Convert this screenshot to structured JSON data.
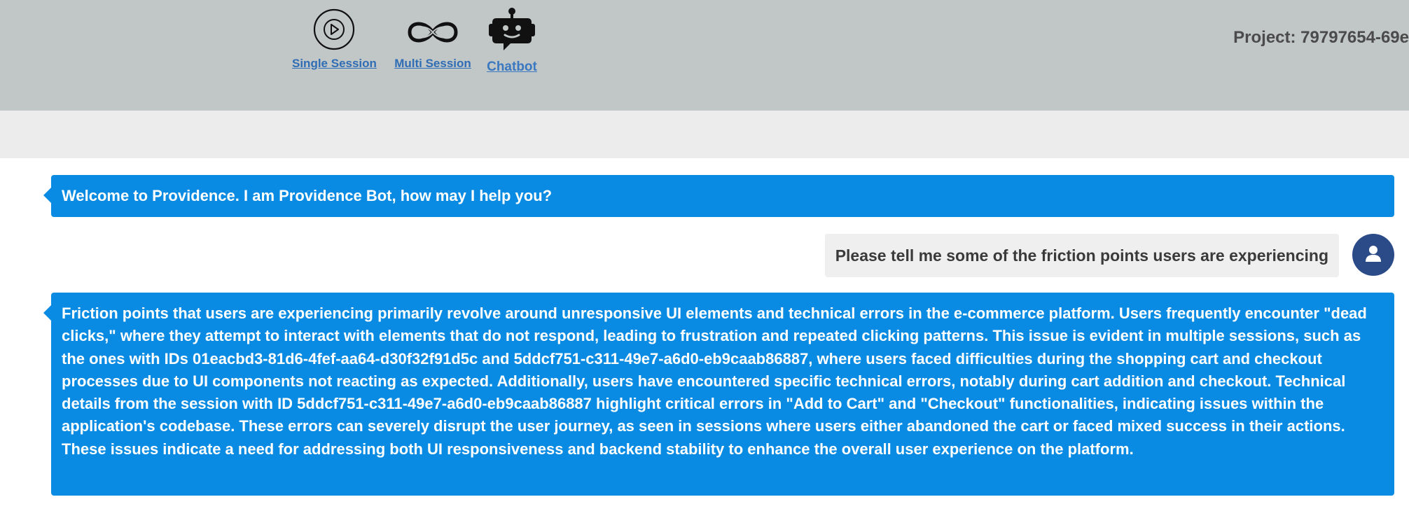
{
  "nav": {
    "single_session_label": "Single Session",
    "multi_session_label": "Multi Session",
    "chatbot_label": "Chatbot"
  },
  "project_label": "Project: 79797654-69e",
  "chat": {
    "welcome": "Welcome to Providence. I am Providence Bot, how may I help you?",
    "user_message": "Please tell me some of the friction points users are experiencing",
    "bot_reply": "Friction points that users are experiencing primarily revolve around unresponsive UI elements and technical errors in the e-commerce platform. Users frequently encounter \"dead clicks,\" where they attempt to interact with elements that do not respond, leading to frustration and repeated clicking patterns. This issue is evident in multiple sessions, such as the ones with IDs 01eacbd3-81d6-4fef-aa64-d30f32f91d5c and 5ddcf751-c311-49e7-a6d0-eb9caab86887, where users faced difficulties during the shopping cart and checkout processes due to UI components not reacting as expected. Additionally, users have encountered specific technical errors, notably during cart addition and checkout. Technical details from the session with ID 5ddcf751-c311-49e7-a6d0-eb9caab86887 highlight critical errors in \"Add to Cart\" and \"Checkout\" functionalities, indicating issues within the application's codebase. These errors can severely disrupt the user journey, as seen in sessions where users either abandoned the cart or faced mixed success in their actions. These issues indicate a need for addressing both UI responsiveness and backend stability to enhance the overall user experience on the platform."
  },
  "colors": {
    "topbar": "#c1c6c6",
    "subbar": "#ececec",
    "bot_bubble": "#0a8be3",
    "user_bubble": "#efefef",
    "avatar": "#2b4a88",
    "link": "#2f6db5"
  },
  "icons": {
    "single_session": "play-circle-icon",
    "multi_session": "infinity-icon",
    "chatbot": "robot-icon",
    "avatar": "user-icon"
  }
}
